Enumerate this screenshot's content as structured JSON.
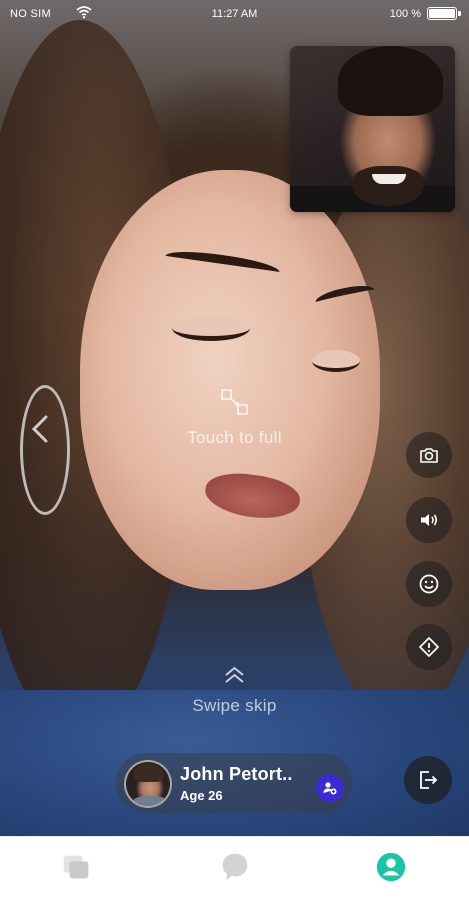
{
  "status_bar": {
    "carrier": "NO SIM",
    "time": "11:27 AM",
    "battery_percent": "100 %",
    "battery_level": 1.0
  },
  "video": {
    "touch_hint": "Touch to full",
    "swipe_hint": "Swipe skip"
  },
  "controls": [
    {
      "icon": "camera-icon"
    },
    {
      "icon": "volume-icon"
    },
    {
      "icon": "emoji-icon"
    },
    {
      "icon": "report-icon"
    }
  ],
  "user": {
    "name": "John Petort..",
    "age": "Age 26"
  },
  "tabs": [
    {
      "icon": "cards-icon",
      "active": false
    },
    {
      "icon": "chat-bubble-icon",
      "active": false
    },
    {
      "icon": "profile-icon",
      "active": true
    }
  ],
  "colors": {
    "accent": "#18c6a6",
    "friend_button": "#3b2bd4",
    "tab_inactive": "#d3d3d3"
  }
}
